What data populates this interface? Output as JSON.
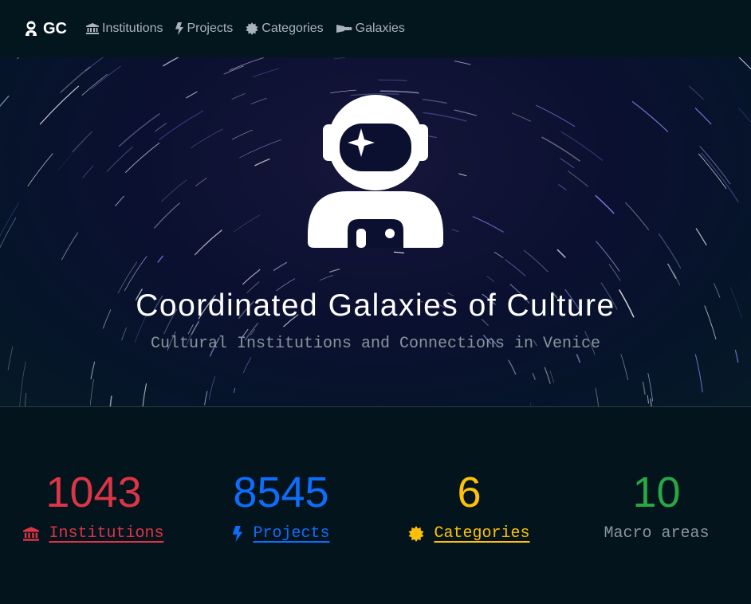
{
  "navbar": {
    "brand": "GC",
    "links": [
      {
        "label": "Institutions",
        "icon": "landmark-icon"
      },
      {
        "label": "Projects",
        "icon": "bolt-icon"
      },
      {
        "label": "Categories",
        "icon": "certificate-icon"
      },
      {
        "label": "Galaxies",
        "icon": "satellite-dish-icon"
      }
    ]
  },
  "hero": {
    "icon": "astronaut-icon",
    "title": "Coordinated Galaxies of Culture",
    "subtitle": "Cultural Institutions and Connections in Venice"
  },
  "stats": [
    {
      "value": "1043",
      "label": "Institutions",
      "color": "#dc3545",
      "icon": "landmark-icon"
    },
    {
      "value": "8545",
      "label": "Projects",
      "color": "#0d6efd",
      "icon": "bolt-icon"
    },
    {
      "value": "6",
      "label": "Categories",
      "color": "#ffc107",
      "icon": "certificate-icon"
    },
    {
      "value": "10",
      "label": "Macro areas",
      "color": "#28a745"
    }
  ]
}
